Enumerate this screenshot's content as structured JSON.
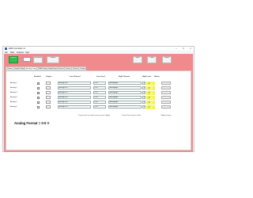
{
  "window": {
    "title": "EMS Controller v1",
    "buttons": {
      "minimize": "–",
      "maximize": "□",
      "close": "×"
    }
  },
  "menu": [
    "File",
    "Start",
    "Analyzer",
    "Help"
  ],
  "toolbar": {
    "connect_label": "Connect",
    "disconnect_label": "Disconnect",
    "status_label": "Status",
    "save_label": "Save",
    "load_label": "Load",
    "reset_label": "Reset"
  },
  "tabs": [
    "Status",
    "Digital Outputs",
    "Analog Outputs",
    "PWM Outputs",
    "Digital Input",
    "Servos",
    "Timers",
    "Charts",
    "Config"
  ],
  "active_tab": "Analog Outputs",
  "table": {
    "headers": [
      "Enabled",
      "Output",
      "Low Channel",
      "Low Level",
      "High Channel",
      "High Level",
      "Status"
    ],
    "rows": [
      {
        "name": "Analog 1",
        "low_channel": "AnalogOut0",
        "low_level": "0.00",
        "high_channel": "AnalogHigh",
        "high_level": "10.00",
        "status": "0"
      },
      {
        "name": "Analog 2",
        "low_channel": "AnalogOut1",
        "low_level": "0.00",
        "high_channel": "AnalogHigh",
        "high_level": "10.00",
        "status": "0"
      },
      {
        "name": "Analog 3",
        "low_channel": "AnalogOut2",
        "low_level": "0.00",
        "high_channel": "AnalogHigh",
        "high_level": "10.00",
        "status": "0"
      },
      {
        "name": "Analog 4",
        "low_channel": "AnalogOut3",
        "low_level": "0.00",
        "high_channel": "AnalogHigh",
        "high_level": "10.00",
        "status": "0"
      },
      {
        "name": "Analog 5",
        "low_channel": "AnalogOut4",
        "low_level": "0.00",
        "high_channel": "AnalogHigh",
        "high_level": "10.00",
        "status": "0"
      },
      {
        "name": "Analog 6",
        "low_channel": "AnalogOut5",
        "low_level": "0.00",
        "high_channel": "AnalogHigh",
        "high_level": "10.00",
        "status": "0"
      }
    ]
  },
  "notes": {
    "left": "* Output levels are written when you press 'Apply'",
    "right": "* Output levels shown in Volts",
    "far_right": "* Apply changes"
  },
  "range_label": "Analog Format = 0-5 V",
  "colors": {
    "panel_bg": "#f08a8c",
    "status_yellow": "#f3f34a",
    "connect_green": "#2fbf4f",
    "app_icon": "#3b5fb0"
  }
}
